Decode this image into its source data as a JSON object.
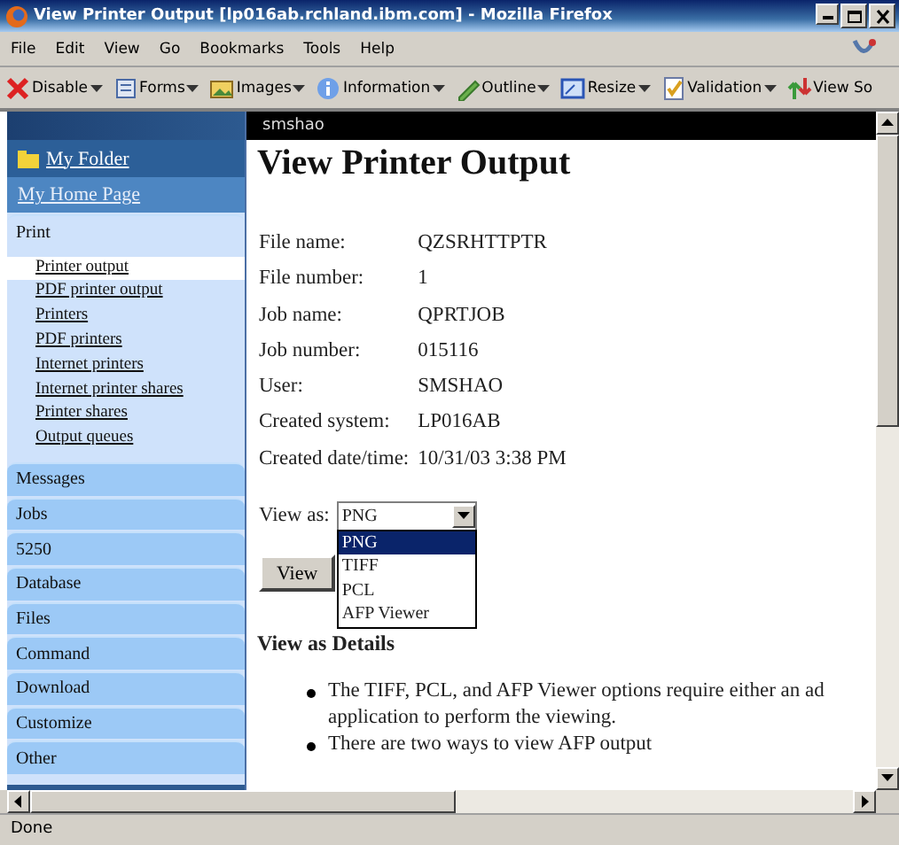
{
  "window": {
    "title": "View Printer Output [lp016ab.rchland.ibm.com] - Mozilla Firefox"
  },
  "menu": [
    "File",
    "Edit",
    "View",
    "Go",
    "Bookmarks",
    "Tools",
    "Help"
  ],
  "toolbar": [
    {
      "label": "Disable",
      "kind": "x"
    },
    {
      "label": "Forms",
      "kind": "form"
    },
    {
      "label": "Images",
      "kind": "image"
    },
    {
      "label": "Information",
      "kind": "info"
    },
    {
      "label": "Outline",
      "kind": "pencil"
    },
    {
      "label": "Resize",
      "kind": "resize"
    },
    {
      "label": "Validation",
      "kind": "check"
    },
    {
      "label": "View So",
      "kind": "source"
    }
  ],
  "header": {
    "user": "smshao"
  },
  "sidebar": {
    "folder": "My Folder",
    "home": "My Home Page",
    "sections": [
      {
        "label": "Print",
        "expanded": true,
        "children": [
          {
            "label": "Printer output",
            "selected": true
          },
          {
            "label": "PDF printer output",
            "selected": false
          },
          {
            "label": "Printers",
            "selected": false
          },
          {
            "label": "PDF printers",
            "selected": false
          },
          {
            "label": "Internet printers",
            "selected": false
          },
          {
            "label": "Internet printer shares",
            "selected": false
          },
          {
            "label": "Printer shares",
            "selected": false
          },
          {
            "label": "Output queues",
            "selected": false
          }
        ]
      },
      {
        "label": "Messages",
        "expanded": false
      },
      {
        "label": "Jobs",
        "expanded": false
      },
      {
        "label": "5250",
        "expanded": false
      },
      {
        "label": "Database",
        "expanded": false
      },
      {
        "label": "Files",
        "expanded": false
      },
      {
        "label": "Command",
        "expanded": false
      },
      {
        "label": "Download",
        "expanded": false
      },
      {
        "label": "Customize",
        "expanded": false
      },
      {
        "label": "Other",
        "expanded": false
      }
    ]
  },
  "page": {
    "title": "View Printer Output",
    "fields": [
      {
        "label": "File name:",
        "value": "QZSRHTTPTR"
      },
      {
        "label": "File number:",
        "value": "1"
      },
      {
        "label": "Job name:",
        "value": "QPRTJOB"
      },
      {
        "label": "Job number:",
        "value": "015116"
      },
      {
        "label": "User:",
        "value": "SMSHAO"
      },
      {
        "label": "Created system:",
        "value": "LP016AB"
      },
      {
        "label": "Created date/time:",
        "value": "10/31/03 3:38 PM"
      }
    ],
    "view_as": {
      "label": "View as:",
      "value": "PNG",
      "options": [
        {
          "label": "PNG",
          "selected": true
        },
        {
          "label": "TIFF",
          "selected": false
        },
        {
          "label": "PCL",
          "selected": false
        },
        {
          "label": "AFP Viewer",
          "selected": false
        }
      ]
    },
    "button": "View",
    "details_heading": "View as Details",
    "bullets": [
      [
        "The TIFF, PCL, and AFP Viewer options require either an ad",
        "application to perform the viewing."
      ],
      [
        "There are two ways to view AFP output"
      ]
    ]
  },
  "status_bar": "Done"
}
